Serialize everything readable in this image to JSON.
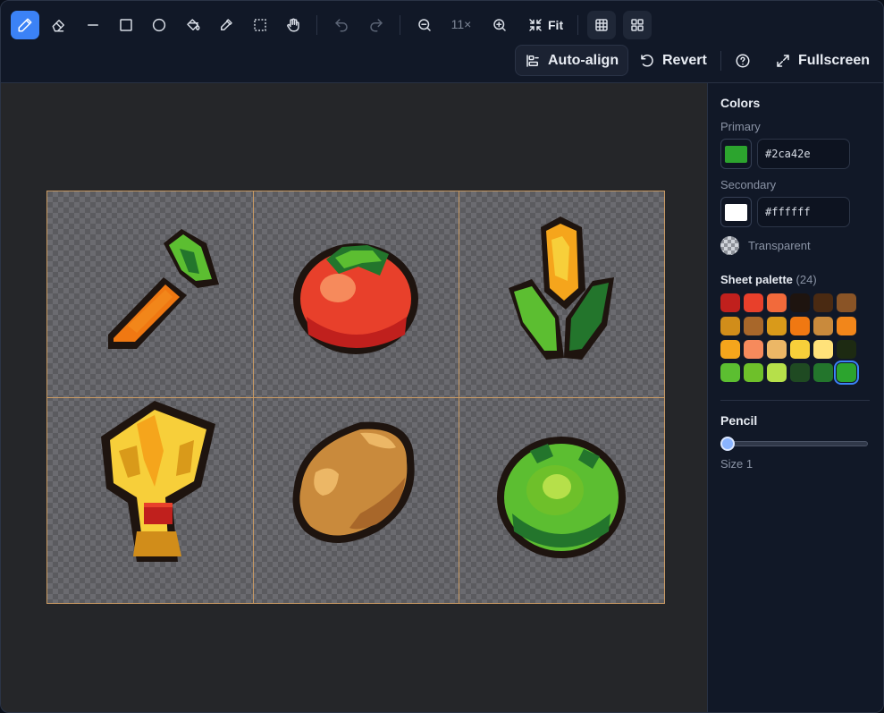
{
  "toolbar": {
    "zoom_label": "11×",
    "fit_label": "Fit",
    "auto_align_label": "Auto-align",
    "revert_label": "Revert",
    "fullscreen_label": "Fullscreen"
  },
  "panel": {
    "colors_title": "Colors",
    "primary_label": "Primary",
    "primary_hex": "#2ca42e",
    "secondary_label": "Secondary",
    "secondary_hex": "#ffffff",
    "transparent_label": "Transparent",
    "palette_title": "Sheet palette",
    "palette_count": "(24)",
    "palette": [
      "#c0201d",
      "#e8402b",
      "#f26a3b",
      "#1e140f",
      "#4a2a12",
      "#8a5426",
      "#d18d1a",
      "#a8672a",
      "#d99a1a",
      "#f07812",
      "#c98a3c",
      "#f2861a",
      "#f5a51c",
      "#f68a5c",
      "#ecb766",
      "#f7cf3a",
      "#ffe27a",
      "#1d2a12",
      "#5cbe31",
      "#6ec02a",
      "#b6e04a",
      "#1f4a22",
      "#23752c",
      "#2ca42e"
    ],
    "palette_selected": 23,
    "tool_title": "Pencil",
    "size_label": "Size 1",
    "size_value": 1
  },
  "sheet": {
    "columns": 3,
    "rows": 2,
    "sprites": [
      "carrot",
      "tomato",
      "corn",
      "wheat",
      "potato",
      "cabbage"
    ]
  }
}
